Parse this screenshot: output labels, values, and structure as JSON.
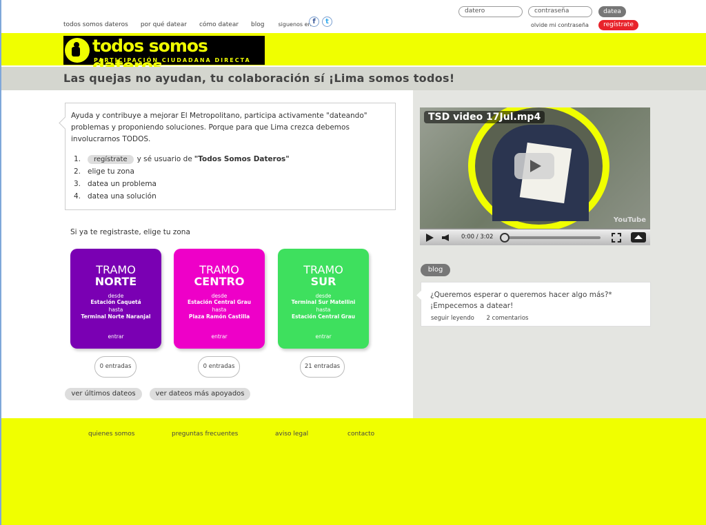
{
  "nav": {
    "items": [
      "todos somos dateros",
      "por qué datear",
      "cómo datear",
      "blog"
    ],
    "follow": "siguenos en"
  },
  "social": {
    "facebook_glyph": "f",
    "twitter_glyph": "t"
  },
  "login": {
    "user_placeholder": "datero",
    "password_placeholder": "contraseña",
    "submit": "datea",
    "forgot": "olvide mi contraseña",
    "register": "regístrate"
  },
  "logo": {
    "title": "todos somos dateros",
    "subtitle": "PARTICIPACIÓN CIUDADANA DIRECTA"
  },
  "tagline": "Las quejas no ayudan, tu colaboración sí ¡Lima somos todos!",
  "intro": {
    "text": "Ayuda y contribuye a mejorar El Metropolitano, participa activamente \"dateando\" problemas y proponiendo soluciones. Porque para que Lima crezca debemos involucrarnos TODOS.",
    "steps": [
      {
        "n": "1.",
        "pill": "regístrate",
        "text": "y sé usuario de",
        "bold": "\"Todos Somos Dateros\""
      },
      {
        "n": "2.",
        "text": "elige tu zona"
      },
      {
        "n": "3.",
        "text": "datea un problema"
      },
      {
        "n": "4.",
        "text": "datea una solución"
      }
    ]
  },
  "zone_label": "Si ya te registraste, elige tu zona",
  "tramos": [
    {
      "line1": "TRAMO",
      "line2": "NORTE",
      "desde": "desde",
      "from": "Estación Caquetá",
      "hasta": "hasta",
      "to": "Terminal Norte Naranjal",
      "enter": "entrar",
      "count": "0 entradas",
      "color": "#7a00b3"
    },
    {
      "line1": "TRAMO",
      "line2": "CENTRO",
      "desde": "desde",
      "from": "Estación Central Grau",
      "hasta": "hasta",
      "to": "Plaza Ramón Castilla",
      "enter": "entrar",
      "count": "0 entradas",
      "color": "#ee00c8"
    },
    {
      "line1": "TRAMO",
      "line2": "SUR",
      "desde": "desde",
      "from": "Terminal Sur Matellini",
      "hasta": "hasta",
      "to": "Estación Central Grau",
      "enter": "entrar",
      "count": "21 entradas",
      "color": "#3ee05e"
    }
  ],
  "buttons": {
    "latest": "ver últimos dateos",
    "most_supported": "ver dateos más apoyados"
  },
  "video": {
    "title": "TSD video 17Jul.mp4",
    "time": "0:00 / 3:02",
    "brand": "YouTube"
  },
  "blog": {
    "tag": "blog",
    "line1": "¿Queremos esperar o queremos hacer algo más?*",
    "line2": "¡Empecemos a datear!",
    "read_more": "seguir leyendo",
    "comments": "2 comentarios"
  },
  "footer": {
    "links": [
      "quienes somos",
      "preguntas frecuentes",
      "aviso legal",
      "contacto"
    ]
  },
  "colors": {
    "brand_yellow": "#f0ff00",
    "register_red": "#e8232b"
  }
}
